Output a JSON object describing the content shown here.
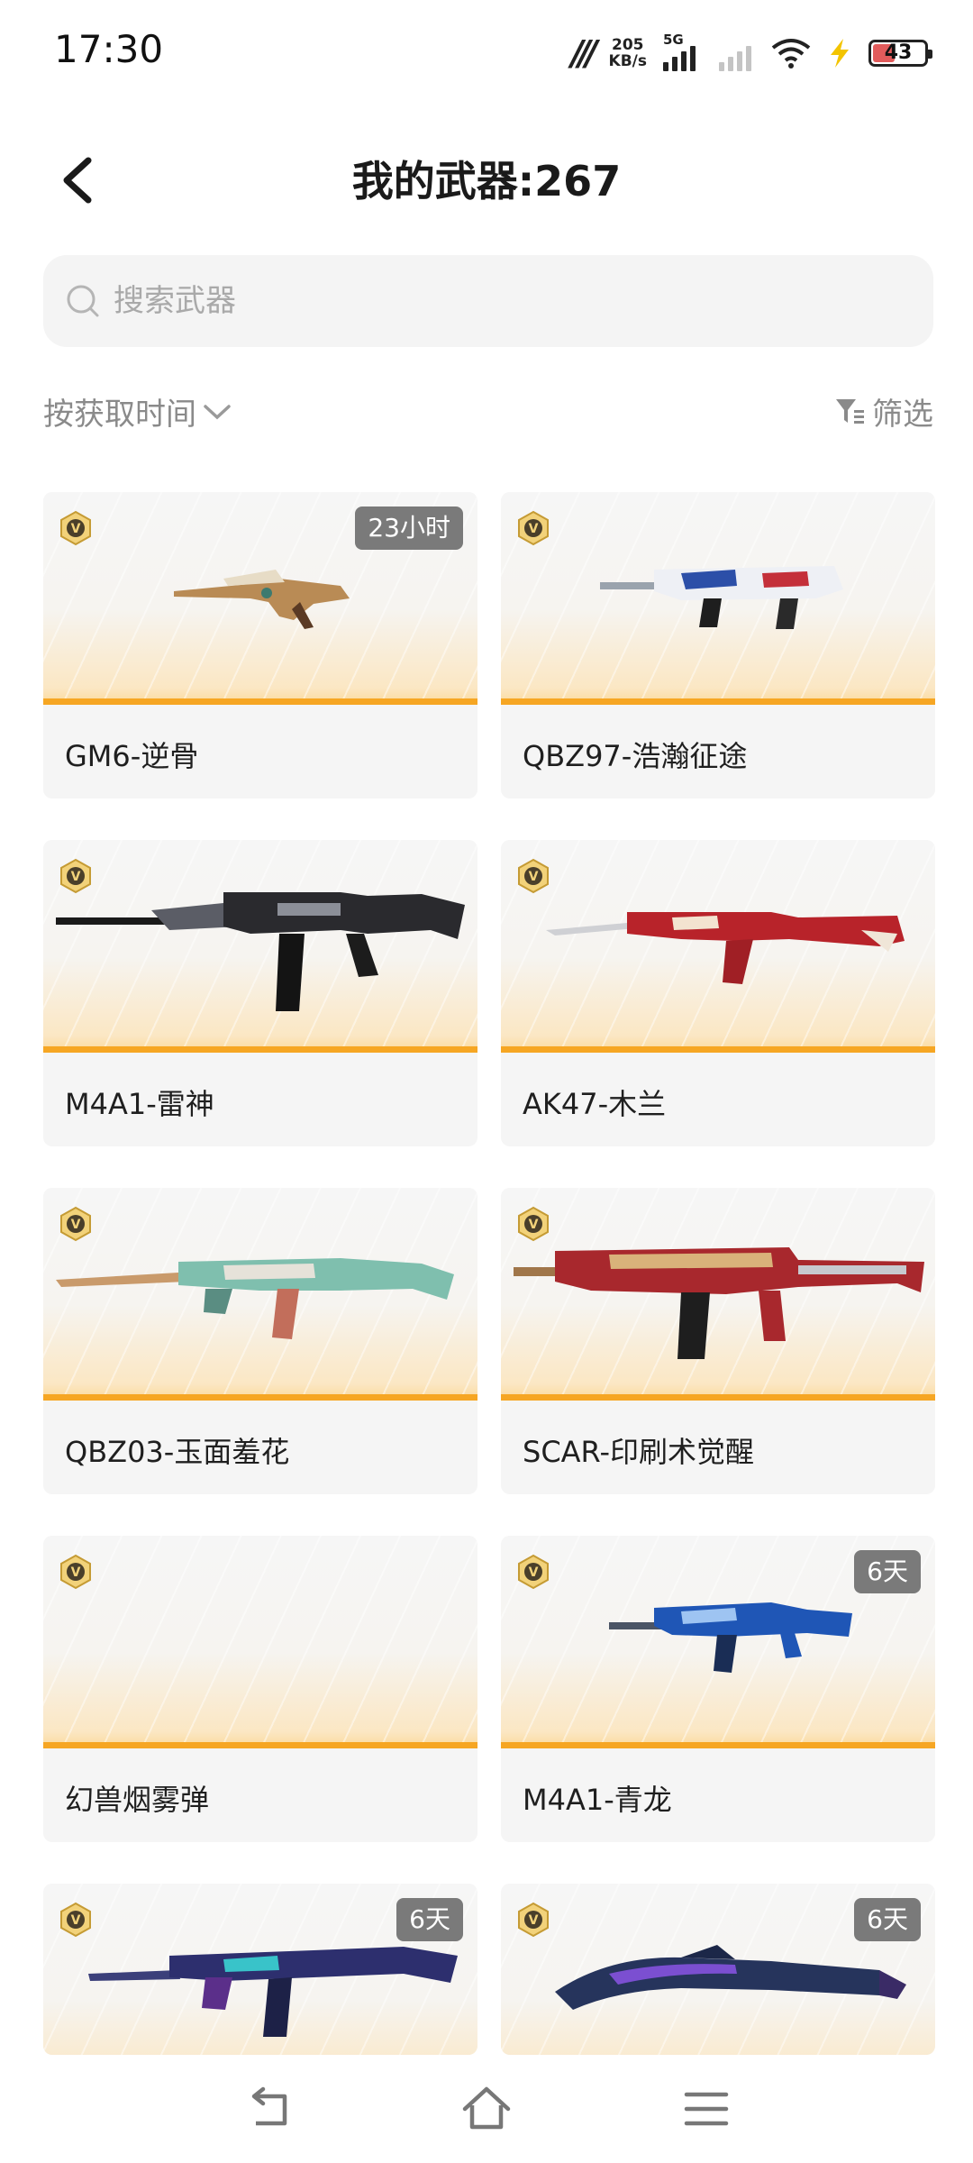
{
  "status_bar": {
    "time": "17:30",
    "carrier_logo": "m",
    "speed_value": "205",
    "speed_unit": "KB/s",
    "network_type": "5G",
    "battery": "43",
    "battery_color": "#e15b5b"
  },
  "header": {
    "title": "我的武器:267",
    "back_icon": "chevron-left-icon"
  },
  "search": {
    "placeholder": "搜索武器",
    "value": ""
  },
  "toolbar": {
    "sort_label": "按获取时间",
    "filter_label": "筛选"
  },
  "accent_color": "#f6a623",
  "weapons": [
    {
      "name": "GM6-逆骨",
      "timer": "23小时"
    },
    {
      "name": "QBZ97-浩瀚征途",
      "timer": ""
    },
    {
      "name": "M4A1-雷神",
      "timer": ""
    },
    {
      "name": "AK47-木兰",
      "timer": ""
    },
    {
      "name": "QBZ03-玉面羞花",
      "timer": ""
    },
    {
      "name": "SCAR-印刷术觉醒",
      "timer": ""
    },
    {
      "name": "幻兽烟雾弹",
      "timer": ""
    },
    {
      "name": "M4A1-青龙",
      "timer": "6天"
    },
    {
      "name": "",
      "timer": "6天"
    },
    {
      "name": "",
      "timer": "6天"
    }
  ],
  "nav": {
    "back_icon": "back-icon",
    "home_icon": "home-icon",
    "menu_icon": "menu-icon"
  }
}
